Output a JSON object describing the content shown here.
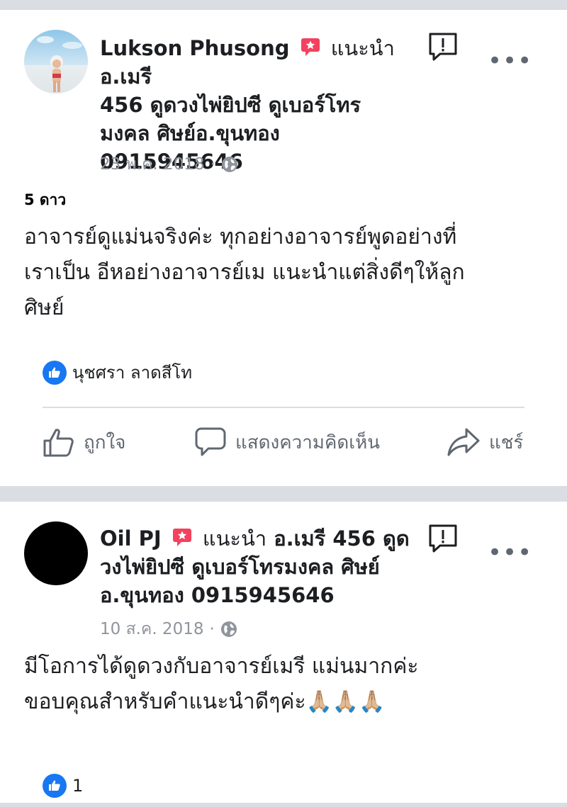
{
  "post1": {
    "author": "Lukson Phusong",
    "recommends_label": "แนะนำ",
    "page_name_line1": "อ.เมรี",
    "page_name_line2": "456 ดูดวงไพ่ยิปซี ดูเบอร์โทร",
    "page_name_line3": "มงคล ศิษย์อ.ขุนทอง",
    "page_name_line4": "0915945646",
    "date": "23 พ.ค. 2018",
    "separator": "·",
    "rating": "5 ดาว",
    "body_line1": "อาจารย์ดูแม่นจริงค่ะ ทุกอย่างอาจารย์พูดอย่างที่",
    "body_line2": "เราเป็น อีหอย่างอาจารย์เม แนะนำแต่สิ่งดีๆให้ลูก",
    "body_line3": "ศิษย์",
    "likers": "นุชศรา ลาดสีโท",
    "icons": {
      "avatar": "beach-photo-avatar",
      "recommend": "recommend-badge-icon",
      "report": "report-icon",
      "more": "more-options-icon",
      "privacy": "globe-icon"
    }
  },
  "actions": {
    "like": "ถูกใจ",
    "comment": "แสดงความคิดเห็น",
    "share": "แชร์"
  },
  "post2": {
    "author": "Oil PJ",
    "recommends_label": "แนะนำ",
    "page_name_line1": "อ.เมรี 456 ดูด",
    "page_name_line2": "วงไพ่ยิปซี ดูเบอร์โทรมงคล ศิษย์",
    "page_name_line3": "อ.ขุนทอง 0915945646",
    "date": "10 ส.ค. 2018",
    "separator": "·",
    "body_line1": "มีโอการได้ดูดวงกับอาจารย์เมรี แม่นมากค่ะ",
    "body_line2": "ขอบคุณสำหรับคำแนะนำดีๆค่ะ🙏🏼🙏🏼🙏🏼",
    "like_count": "1",
    "icons": {
      "avatar": "black-circle-avatar",
      "recommend": "recommend-badge-icon",
      "report": "report-icon",
      "more": "more-options-icon",
      "privacy": "globe-icon"
    }
  },
  "colors": {
    "accent_blue": "#1877f2",
    "recommend_red": "#f3425f",
    "meta_gray": "#90949c",
    "divider": "#dadde1"
  }
}
